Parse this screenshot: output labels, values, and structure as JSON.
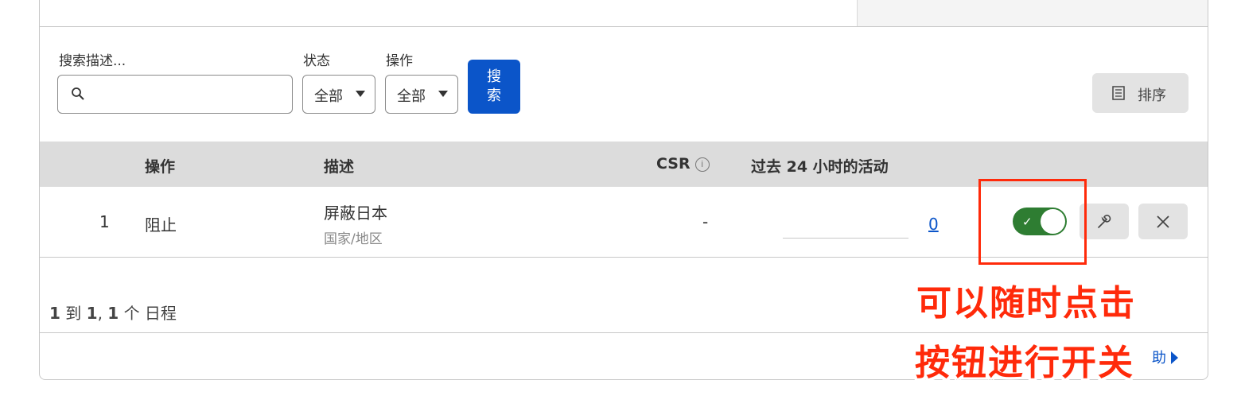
{
  "filters": {
    "search_label": "搜索描述...",
    "search_value": "",
    "status_label": "状态",
    "status_value": "全部",
    "action_label": "操作",
    "action_value": "全部",
    "search_button": "搜索",
    "sort_button": "排序"
  },
  "table": {
    "headers": {
      "action": "操作",
      "description": "描述",
      "csr": "CSR",
      "activity": "过去 24 小时的活动"
    },
    "rows": [
      {
        "index": "1",
        "action": "阻止",
        "description": "屏蔽日本",
        "type": "国家/地区",
        "csr": "-",
        "activity_count": "0",
        "enabled": true
      }
    ]
  },
  "footer": {
    "range_from": "1",
    "range_to_word": "到",
    "range_to": "1",
    "total": "1",
    "unit": "个 日程",
    "help": "助"
  },
  "annotation": {
    "line1": "可以随时点击",
    "line2": "按钮进行开关",
    "color": "#ff2a0a"
  },
  "colors": {
    "primary": "#0b55c9",
    "toggle_on": "#2e7d32",
    "header_bg": "#dcdcdc"
  },
  "icons": {
    "search": "magnifier-icon",
    "sort": "list-icon",
    "info": "info-icon",
    "edit": "wrench-icon",
    "delete": "close-icon",
    "check": "check-icon"
  }
}
